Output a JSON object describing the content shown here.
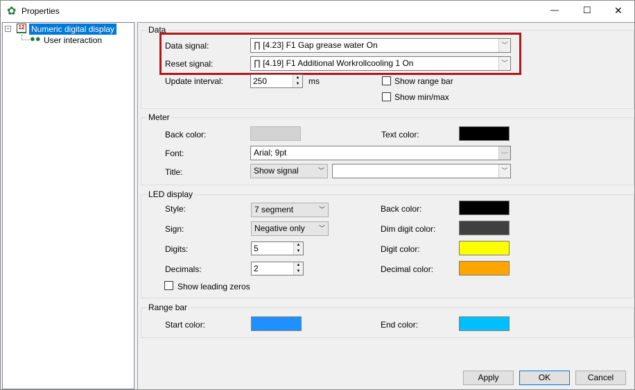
{
  "window": {
    "title": "Properties",
    "icon": "gear-icon",
    "minimize": "—",
    "maximize": "☐",
    "close": "✕"
  },
  "tree": [
    {
      "label": "Numeric digital display",
      "icon": "numeric-display-icon",
      "selected": true
    },
    {
      "label": "User interaction",
      "icon": "users-icon"
    }
  ],
  "data": {
    "title": "Data",
    "data_signal_label": "Data signal:",
    "data_signal_value": "[4.23] F1 Gap grease water On",
    "reset_signal_label": "Reset signal:",
    "reset_signal_value": "[4.19] F1 Additional Workrollcooling 1 On",
    "update_label": "Update interval:",
    "update_value": "250",
    "update_unit": "ms",
    "show_range_bar": "Show range bar",
    "show_minmax": "Show min/max",
    "highlight_color": "#b0161c"
  },
  "meter": {
    "title": "Meter",
    "back_color_label": "Back color:",
    "back_color": "#d3d3d3",
    "text_color_label": "Text color:",
    "text_color": "#000000",
    "font_label": "Font:",
    "font_value": "Arial; 9pt",
    "font_button": "...",
    "title_label": "Title:",
    "title_mode": "Show signal",
    "title_value": ""
  },
  "led": {
    "title": "LED display",
    "style_label": "Style:",
    "style_value": "7 segment",
    "sign_label": "Sign:",
    "sign_value": "Negative only",
    "digits_label": "Digits:",
    "digits_value": "5",
    "decimals_label": "Decimals:",
    "decimals_value": "2",
    "leading_zeros": "Show leading zeros",
    "back_color_label": "Back color:",
    "back_color": "#000000",
    "dim_label": "Dim digit color:",
    "dim_color": "#404040",
    "digit_label": "Digit color:",
    "digit_color": "#ffff00",
    "decimal_label": "Decimal color:",
    "decimal_color": "#ffa500"
  },
  "range": {
    "title": "Range bar",
    "start_label": "Start color:",
    "start_color": "#1e90ff",
    "end_label": "End color:",
    "end_color": "#00bfff"
  },
  "buttons": {
    "apply": "Apply",
    "ok": "OK",
    "cancel": "Cancel"
  }
}
